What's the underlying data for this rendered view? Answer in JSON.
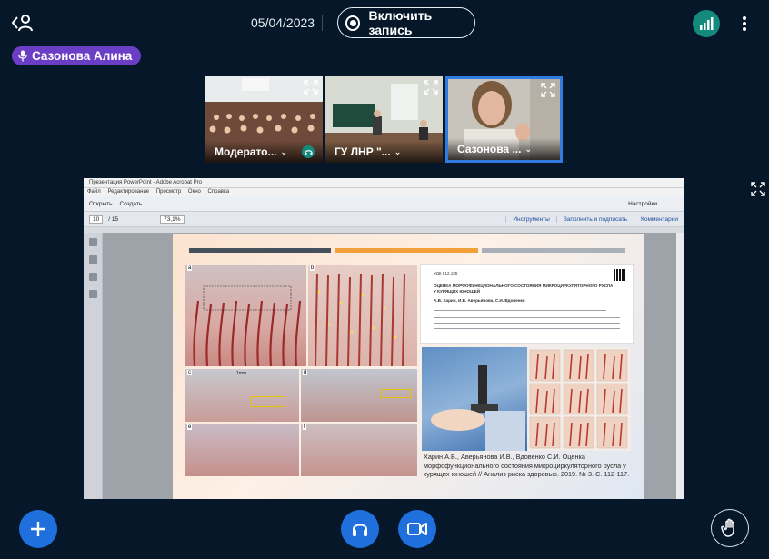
{
  "header": {
    "leave_icon": "user-leave-icon",
    "date": "05/04/2023",
    "record_button_label": "Включить запись",
    "connection_icon": "signal-bars-icon",
    "menu_icon": "kebab-menu-icon",
    "talking_indicator": {
      "name": "Сазонова Алина",
      "icon": "microphone-icon"
    }
  },
  "thumbnails": [
    {
      "label": "Модерато...",
      "icon": "headphones-icon"
    },
    {
      "label": "ГУ ЛНР \"...",
      "icon": "chevron-down-icon"
    },
    {
      "label": "Сазонова ...",
      "icon": "chevron-down-icon"
    }
  ],
  "screenshare": {
    "window_title": "Презентация PowerPoint - Adobe Acrobat Pro",
    "menu": [
      "Файл",
      "Редактирование",
      "Просмотр",
      "Окно",
      "Справка"
    ],
    "toolbar": {
      "open": "Открыть",
      "create": "Создать",
      "settings": "Настройки"
    },
    "nav": {
      "page": "10",
      "total": "/ 15",
      "zoom": "73,1%"
    },
    "panels": [
      "Инструменты",
      "Заполнить и подписать",
      "Комментарии"
    ],
    "slide": {
      "panel_letters": [
        "a",
        "b",
        "c",
        "d",
        "e",
        "f"
      ],
      "scale_label": "1mm",
      "paper": {
        "udk": "УДК 612.135",
        "title": "ОЦЕНКА МОРФОФУНКЦИОНАЛЬНОГО СОСТОЯНИЯ МИКРОЦИРКУЛЯТОРНОГО РУСЛА У КУРЯЩИХ ЮНОШЕЙ",
        "authors": "А.В. Харин, И.В. Аверьянова, С.И. Вдовенко"
      },
      "caption": "Харин А.В., Аверьянова И.В., Вдовенко С.И. Оценка морфофункционального состояния микроциркуляторного русла у курящих юношей // Анализ риска здоровью. 2019. № 3. С. 112-117."
    }
  },
  "controls": {
    "actions_icon": "plus-icon",
    "audio_icon": "headphones-icon",
    "video_icon": "video-camera-icon",
    "raise_hand_icon": "raise-hand-icon"
  },
  "colors": {
    "background": "#06172a",
    "accent_blue": "#1f6fdc",
    "talking_purple": "#6a3fc6",
    "signal_green": "#138a7b",
    "active_thumb_border": "#2f7be0"
  }
}
